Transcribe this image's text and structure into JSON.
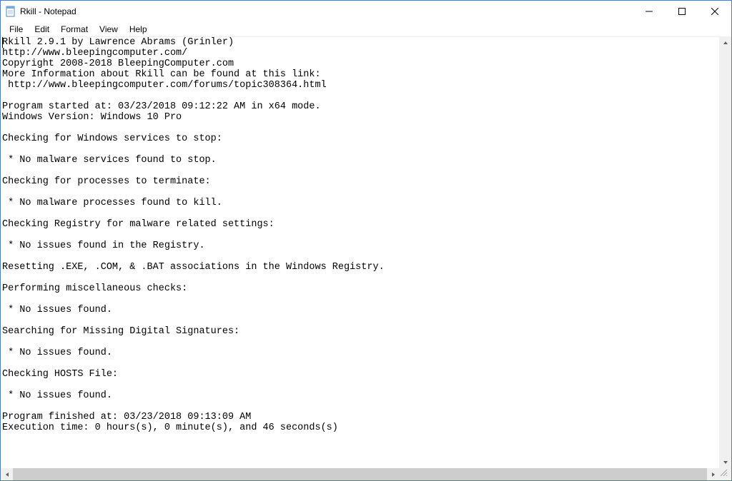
{
  "window": {
    "title": "Rkill - Notepad"
  },
  "menu": {
    "file": "File",
    "edit": "Edit",
    "format": "Format",
    "view": "View",
    "help": "Help"
  },
  "lines": [
    "Rkill 2.9.1 by Lawrence Abrams (Grinler)",
    "http://www.bleepingcomputer.com/",
    "Copyright 2008-2018 BleepingComputer.com",
    "More Information about Rkill can be found at this link:",
    " http://www.bleepingcomputer.com/forums/topic308364.html",
    "",
    "Program started at: 03/23/2018 09:12:22 AM in x64 mode.",
    "Windows Version: Windows 10 Pro",
    "",
    "Checking for Windows services to stop:",
    "",
    " * No malware services found to stop.",
    "",
    "Checking for processes to terminate:",
    "",
    " * No malware processes found to kill.",
    "",
    "Checking Registry for malware related settings:",
    "",
    " * No issues found in the Registry.",
    "",
    "Resetting .EXE, .COM, & .BAT associations in the Windows Registry.",
    "",
    "Performing miscellaneous checks:",
    "",
    " * No issues found.",
    "",
    "Searching for Missing Digital Signatures:",
    "",
    " * No issues found.",
    "",
    "Checking HOSTS File:",
    "",
    " * No issues found.",
    "",
    "Program finished at: 03/23/2018 09:13:09 AM",
    "Execution time: 0 hours(s), 0 minute(s), and 46 seconds(s)"
  ]
}
